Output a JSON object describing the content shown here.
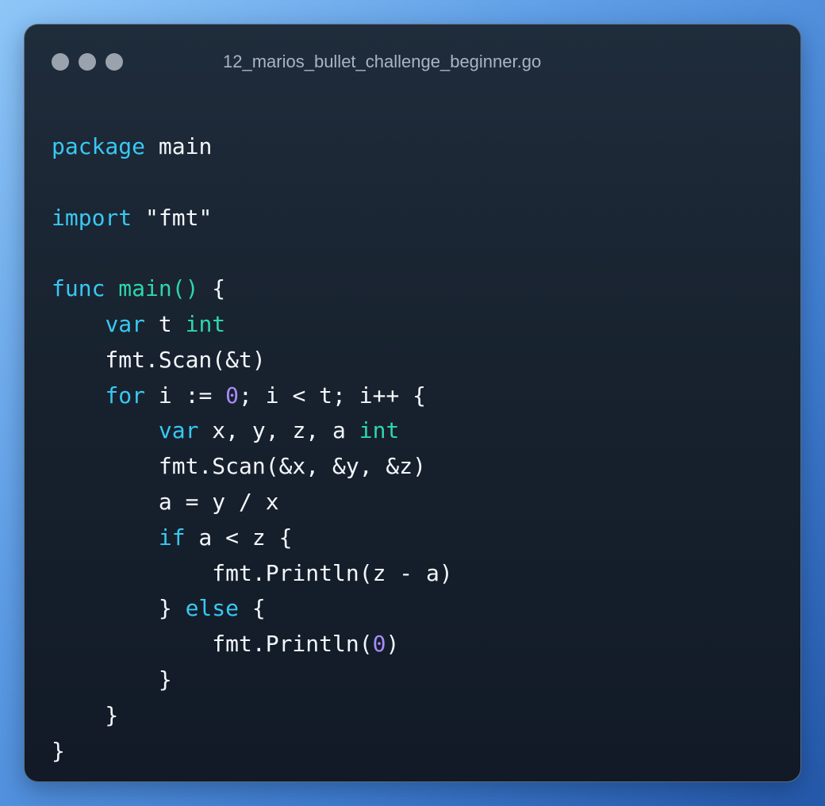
{
  "window": {
    "filename": "12_marios_bullet_challenge_beginner.go",
    "dot_colors": [
      "#9aa3ad",
      "#9aa3ad",
      "#9aa3ad"
    ]
  },
  "colors": {
    "keyword": "#38c8f2",
    "function": "#2ed6a9",
    "type": "#2ed6a9",
    "number": "#a78bfa",
    "text": "#f3f6fa"
  },
  "code": {
    "lines": [
      [
        {
          "t": "package",
          "k": "keyword"
        },
        {
          "t": " main",
          "k": "ident"
        }
      ],
      [],
      [
        {
          "t": "import",
          "k": "keyword"
        },
        {
          "t": " \"fmt\"",
          "k": "string"
        }
      ],
      [],
      [
        {
          "t": "func",
          "k": "keyword"
        },
        {
          "t": " ",
          "k": "plain"
        },
        {
          "t": "main",
          "k": "func"
        },
        {
          "t": "()",
          "k": "func"
        },
        {
          "t": " {",
          "k": "punct"
        }
      ],
      [
        {
          "t": "    ",
          "k": "plain"
        },
        {
          "t": "var",
          "k": "keyword"
        },
        {
          "t": " t ",
          "k": "ident"
        },
        {
          "t": "int",
          "k": "type"
        }
      ],
      [
        {
          "t": "    fmt.Scan(&t)",
          "k": "ident"
        }
      ],
      [
        {
          "t": "    ",
          "k": "plain"
        },
        {
          "t": "for",
          "k": "keyword"
        },
        {
          "t": " i := ",
          "k": "ident"
        },
        {
          "t": "0",
          "k": "number"
        },
        {
          "t": "; i < t; i++ {",
          "k": "ident"
        }
      ],
      [
        {
          "t": "        ",
          "k": "plain"
        },
        {
          "t": "var",
          "k": "keyword"
        },
        {
          "t": " x, y, z, a ",
          "k": "ident"
        },
        {
          "t": "int",
          "k": "type"
        }
      ],
      [
        {
          "t": "        fmt.Scan(&x, &y, &z)",
          "k": "ident"
        }
      ],
      [
        {
          "t": "        a = y / x",
          "k": "ident"
        }
      ],
      [
        {
          "t": "        ",
          "k": "plain"
        },
        {
          "t": "if",
          "k": "keyword"
        },
        {
          "t": " a < z {",
          "k": "ident"
        }
      ],
      [
        {
          "t": "            fmt.Println(z - a)",
          "k": "ident"
        }
      ],
      [
        {
          "t": "        } ",
          "k": "punct"
        },
        {
          "t": "else",
          "k": "keyword"
        },
        {
          "t": " {",
          "k": "punct"
        }
      ],
      [
        {
          "t": "            fmt.Println(",
          "k": "ident"
        },
        {
          "t": "0",
          "k": "number"
        },
        {
          "t": ")",
          "k": "punct"
        }
      ],
      [
        {
          "t": "        }",
          "k": "punct"
        }
      ],
      [
        {
          "t": "    }",
          "k": "punct"
        }
      ],
      [
        {
          "t": "}",
          "k": "punct"
        }
      ]
    ]
  }
}
